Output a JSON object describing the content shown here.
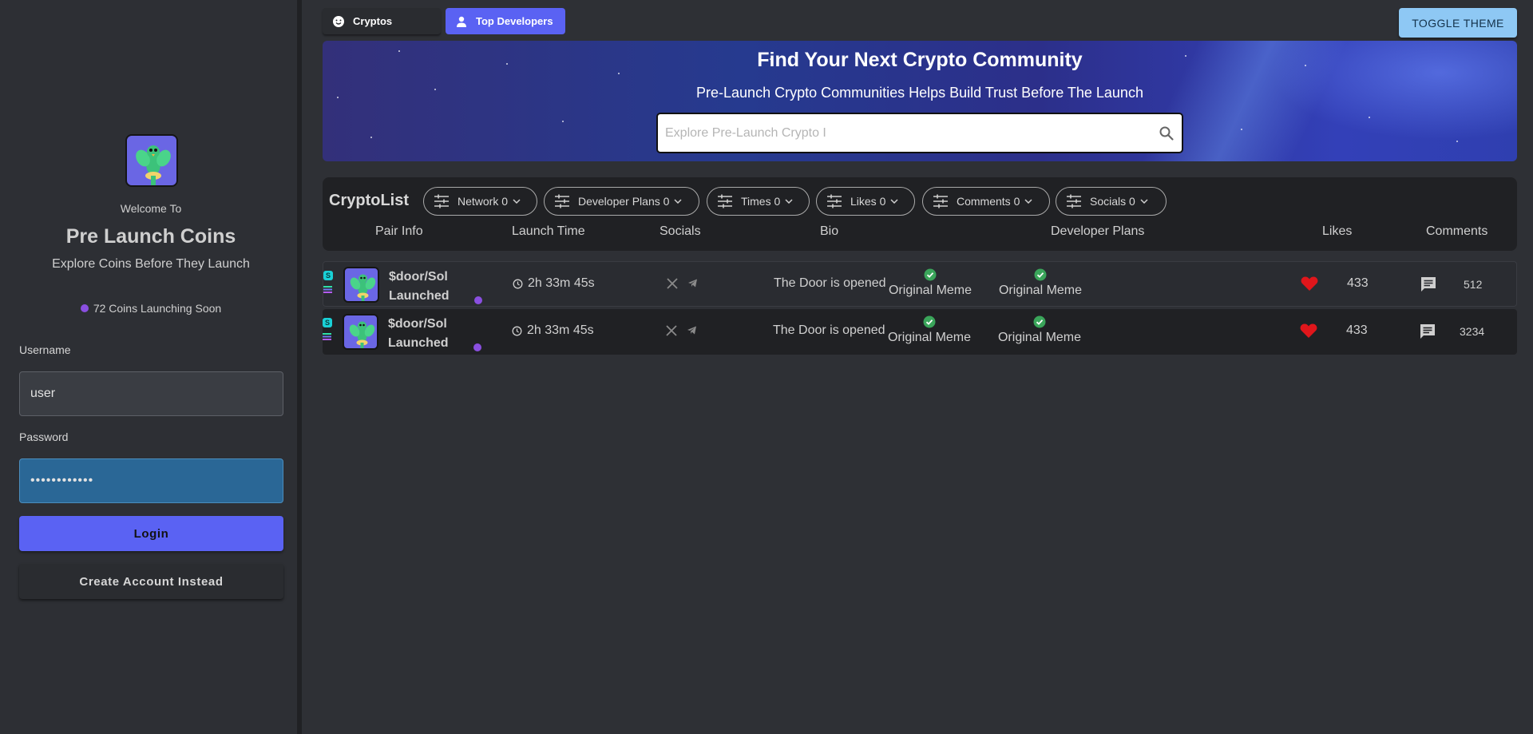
{
  "sidebar": {
    "welcome": "Welcome To",
    "brand": "Pre Launch Coins",
    "tagline": "Explore Coins Before They Launch",
    "launch_count": "72 Coins Launching Soon",
    "username_label": "Username",
    "username_value": "user",
    "password_label": "Password",
    "password_value": "••••••••••••",
    "login_label": "Login",
    "create_label": "Create Account Instead"
  },
  "nav": {
    "tabs": [
      {
        "label": "Cryptos",
        "icon": "smiley-icon"
      },
      {
        "label": "Top Developers",
        "icon": "person-icon"
      }
    ],
    "toggle_theme": "TOGGLE THEME"
  },
  "hero": {
    "title": "Find Your Next Crypto Community",
    "subtitle": "Pre-Launch Crypto Communities Helps Build Trust Before The Launch",
    "search_placeholder": "Explore Pre-Launch Crypto I"
  },
  "list": {
    "title": "CryptoList",
    "filters": [
      {
        "label": "Network 0"
      },
      {
        "label": "Developer Plans 0"
      },
      {
        "label": "Times 0"
      },
      {
        "label": "Likes 0"
      },
      {
        "label": "Comments 0"
      },
      {
        "label": "Socials 0"
      }
    ],
    "columns": [
      "Pair Info",
      "Launch Time",
      "Socials",
      "Bio",
      "Developer Plans",
      "Likes",
      "Comments"
    ],
    "rows": [
      {
        "pair": "$door/Sol",
        "status": "Launched",
        "launch_time": "2h 33m 45s",
        "bio": "The Door is opened",
        "plans": [
          "Original Meme",
          "Original Meme"
        ],
        "likes": "433",
        "comments": "512"
      },
      {
        "pair": "$door/Sol",
        "status": "Launched",
        "launch_time": "2h 33m 45s",
        "bio": "The Door is opened",
        "plans": [
          "Original Meme",
          "Original Meme"
        ],
        "likes": "433",
        "comments": "3234"
      }
    ]
  },
  "colors": {
    "accent": "#5a62f3",
    "toggle": "#8ec8f4",
    "status_dot": "#8a4fe0",
    "heart": "#e0161b",
    "check": "#3aa55a"
  }
}
